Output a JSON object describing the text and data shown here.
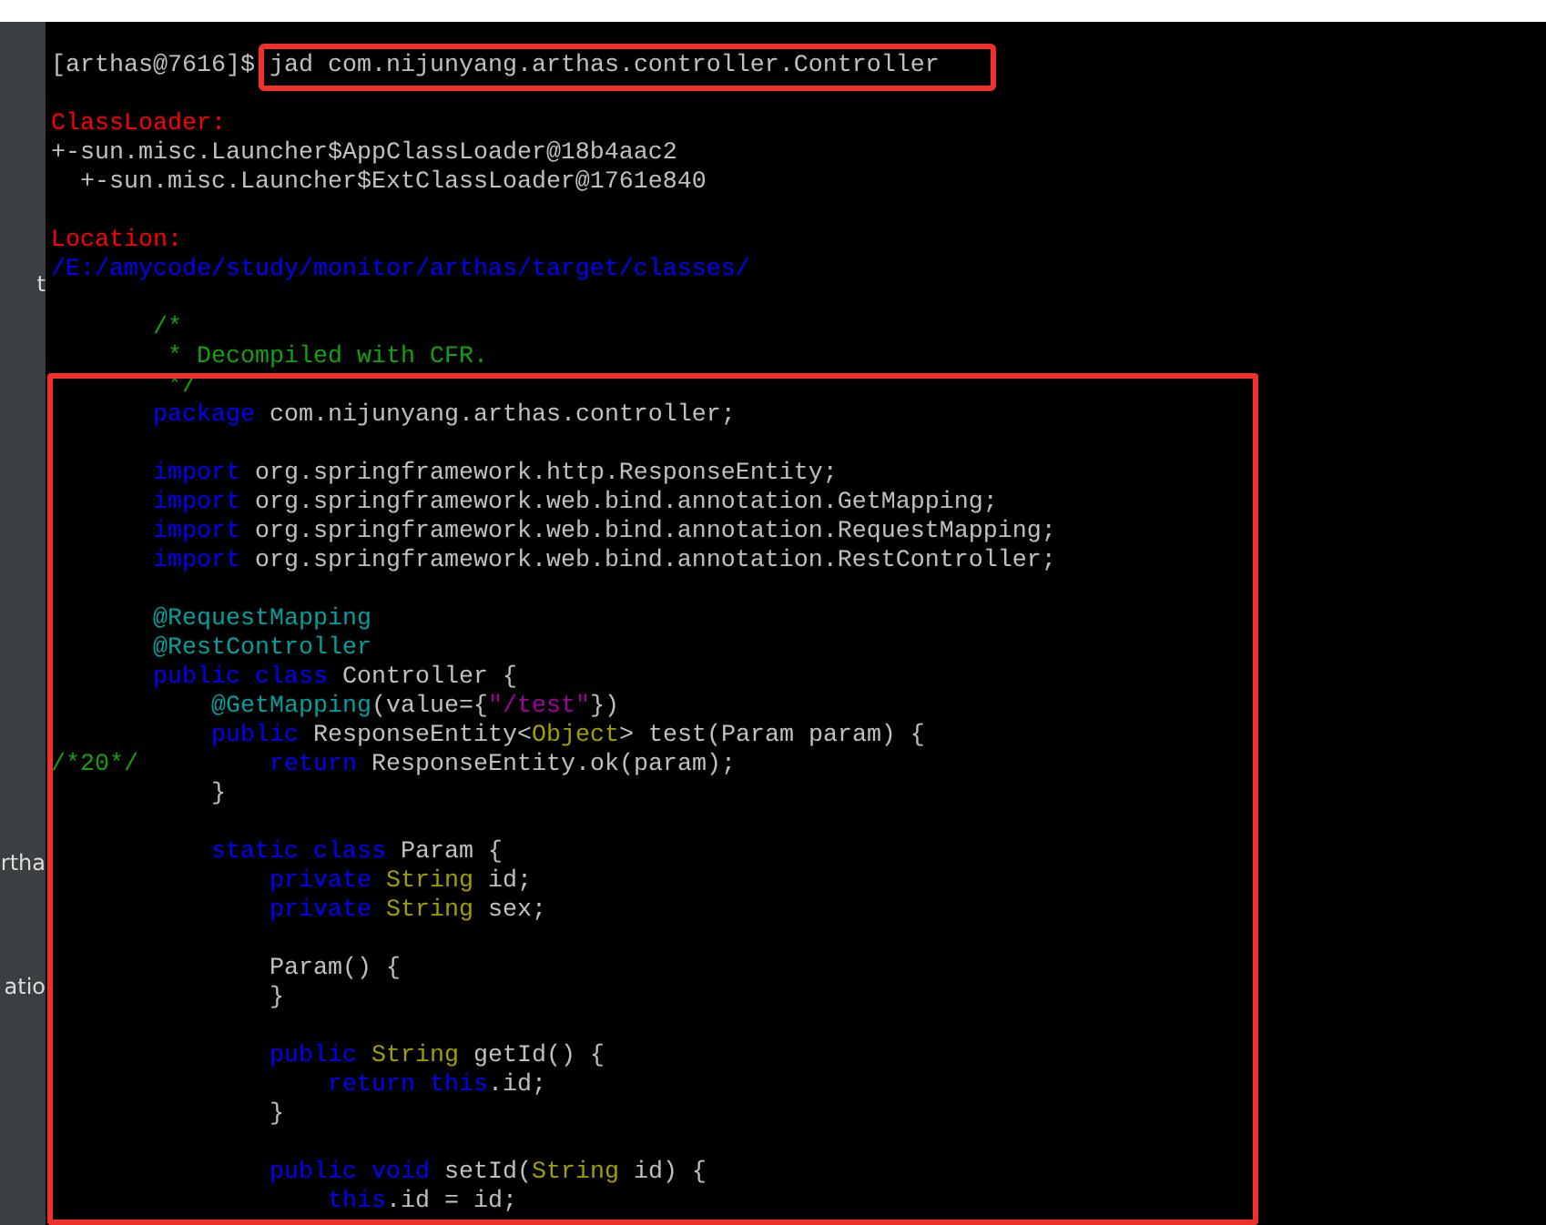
{
  "sidebar": {
    "fragments": [
      {
        "text": "t",
        "selected": false
      },
      {
        "text": "rtha",
        "selected": false
      },
      {
        "text": "atio",
        "selected": false
      }
    ]
  },
  "terminal": {
    "prompt": "[arthas@7616]$",
    "command": "jad com.nijunyang.arthas.controller.Controller",
    "lines": [
      {
        "kind": "blank"
      },
      {
        "kind": "code",
        "segments": [
          {
            "kind": "heading",
            "text": "ClassLoader:"
          }
        ]
      },
      {
        "kind": "code",
        "segments": [
          {
            "kind": "plain",
            "text": "+-sun.misc.Launcher$AppClassLoader@18b4aac2"
          }
        ]
      },
      {
        "kind": "code",
        "segments": [
          {
            "kind": "plain",
            "text": "  +-sun.misc.Launcher$ExtClassLoader@1761e840"
          }
        ]
      },
      {
        "kind": "blank"
      },
      {
        "kind": "code",
        "segments": [
          {
            "kind": "heading",
            "text": "Location:"
          }
        ]
      },
      {
        "kind": "code",
        "segments": [
          {
            "kind": "path",
            "text": "/E:/amycode/study/monitor/arthas/target/classes/"
          }
        ]
      },
      {
        "kind": "blank"
      },
      {
        "kind": "code",
        "segments": [
          {
            "kind": "comment",
            "text": "       /*"
          }
        ]
      },
      {
        "kind": "code",
        "segments": [
          {
            "kind": "comment",
            "text": "        * Decompiled with CFR."
          }
        ]
      },
      {
        "kind": "code",
        "segments": [
          {
            "kind": "comment",
            "text": "        */"
          }
        ]
      },
      {
        "kind": "code",
        "segments": [
          {
            "kind": "keyword",
            "text": "       package"
          },
          {
            "kind": "plain",
            "text": " com.nijunyang.arthas.controller;"
          }
        ]
      },
      {
        "kind": "blank"
      },
      {
        "kind": "code",
        "segments": [
          {
            "kind": "keyword",
            "text": "       import"
          },
          {
            "kind": "plain",
            "text": " org.springframework.http.ResponseEntity;"
          }
        ]
      },
      {
        "kind": "code",
        "segments": [
          {
            "kind": "keyword",
            "text": "       import"
          },
          {
            "kind": "plain",
            "text": " org.springframework.web.bind.annotation.GetMapping;"
          }
        ]
      },
      {
        "kind": "code",
        "segments": [
          {
            "kind": "keyword",
            "text": "       import"
          },
          {
            "kind": "plain",
            "text": " org.springframework.web.bind.annotation.RequestMapping;"
          }
        ]
      },
      {
        "kind": "code",
        "segments": [
          {
            "kind": "keyword",
            "text": "       import"
          },
          {
            "kind": "plain",
            "text": " org.springframework.web.bind.annotation.RestController;"
          }
        ]
      },
      {
        "kind": "blank"
      },
      {
        "kind": "code",
        "segments": [
          {
            "kind": "annotation",
            "text": "       @RequestMapping"
          }
        ]
      },
      {
        "kind": "code",
        "segments": [
          {
            "kind": "annotation",
            "text": "       @RestController"
          }
        ]
      },
      {
        "kind": "code",
        "segments": [
          {
            "kind": "keyword",
            "text": "       public class"
          },
          {
            "kind": "plain",
            "text": " Controller {"
          }
        ]
      },
      {
        "kind": "code",
        "segments": [
          {
            "kind": "annotation",
            "text": "           @GetMapping"
          },
          {
            "kind": "plain",
            "text": "(value={"
          },
          {
            "kind": "string",
            "text": "\"/test\""
          },
          {
            "kind": "plain",
            "text": "})"
          }
        ]
      },
      {
        "kind": "code",
        "segments": [
          {
            "kind": "keyword",
            "text": "           public"
          },
          {
            "kind": "plain",
            "text": " ResponseEntity<"
          },
          {
            "kind": "type",
            "text": "Object"
          },
          {
            "kind": "plain",
            "text": "> test(Param param) {"
          }
        ]
      },
      {
        "kind": "code",
        "segments": [
          {
            "kind": "comment",
            "text": "/*20*/"
          },
          {
            "kind": "keyword",
            "text": "         return"
          },
          {
            "kind": "plain",
            "text": " ResponseEntity.ok(param);"
          }
        ]
      },
      {
        "kind": "code",
        "segments": [
          {
            "kind": "plain",
            "text": "           }"
          }
        ]
      },
      {
        "kind": "blank"
      },
      {
        "kind": "code",
        "segments": [
          {
            "kind": "keyword",
            "text": "           static class"
          },
          {
            "kind": "plain",
            "text": " Param {"
          }
        ]
      },
      {
        "kind": "code",
        "segments": [
          {
            "kind": "keyword",
            "text": "               private"
          },
          {
            "kind": "type",
            "text": " String"
          },
          {
            "kind": "plain",
            "text": " id;"
          }
        ]
      },
      {
        "kind": "code",
        "segments": [
          {
            "kind": "keyword",
            "text": "               private"
          },
          {
            "kind": "type",
            "text": " String"
          },
          {
            "kind": "plain",
            "text": " sex;"
          }
        ]
      },
      {
        "kind": "blank"
      },
      {
        "kind": "code",
        "segments": [
          {
            "kind": "plain",
            "text": "               Param() {"
          }
        ]
      },
      {
        "kind": "code",
        "segments": [
          {
            "kind": "plain",
            "text": "               }"
          }
        ]
      },
      {
        "kind": "blank"
      },
      {
        "kind": "code",
        "segments": [
          {
            "kind": "keyword",
            "text": "               public"
          },
          {
            "kind": "type",
            "text": " String"
          },
          {
            "kind": "plain",
            "text": " getId() {"
          }
        ]
      },
      {
        "kind": "code",
        "segments": [
          {
            "kind": "keyword",
            "text": "                   return this"
          },
          {
            "kind": "plain",
            "text": ".id;"
          }
        ]
      },
      {
        "kind": "code",
        "segments": [
          {
            "kind": "plain",
            "text": "               }"
          }
        ]
      },
      {
        "kind": "blank"
      },
      {
        "kind": "code",
        "segments": [
          {
            "kind": "keyword",
            "text": "               public void"
          },
          {
            "kind": "plain",
            "text": " setId("
          },
          {
            "kind": "type",
            "text": "String"
          },
          {
            "kind": "plain",
            "text": " id) {"
          }
        ]
      },
      {
        "kind": "code",
        "segments": [
          {
            "kind": "keyword",
            "text": "                   this"
          },
          {
            "kind": "plain",
            "text": ".id = id;"
          }
        ]
      }
    ]
  }
}
